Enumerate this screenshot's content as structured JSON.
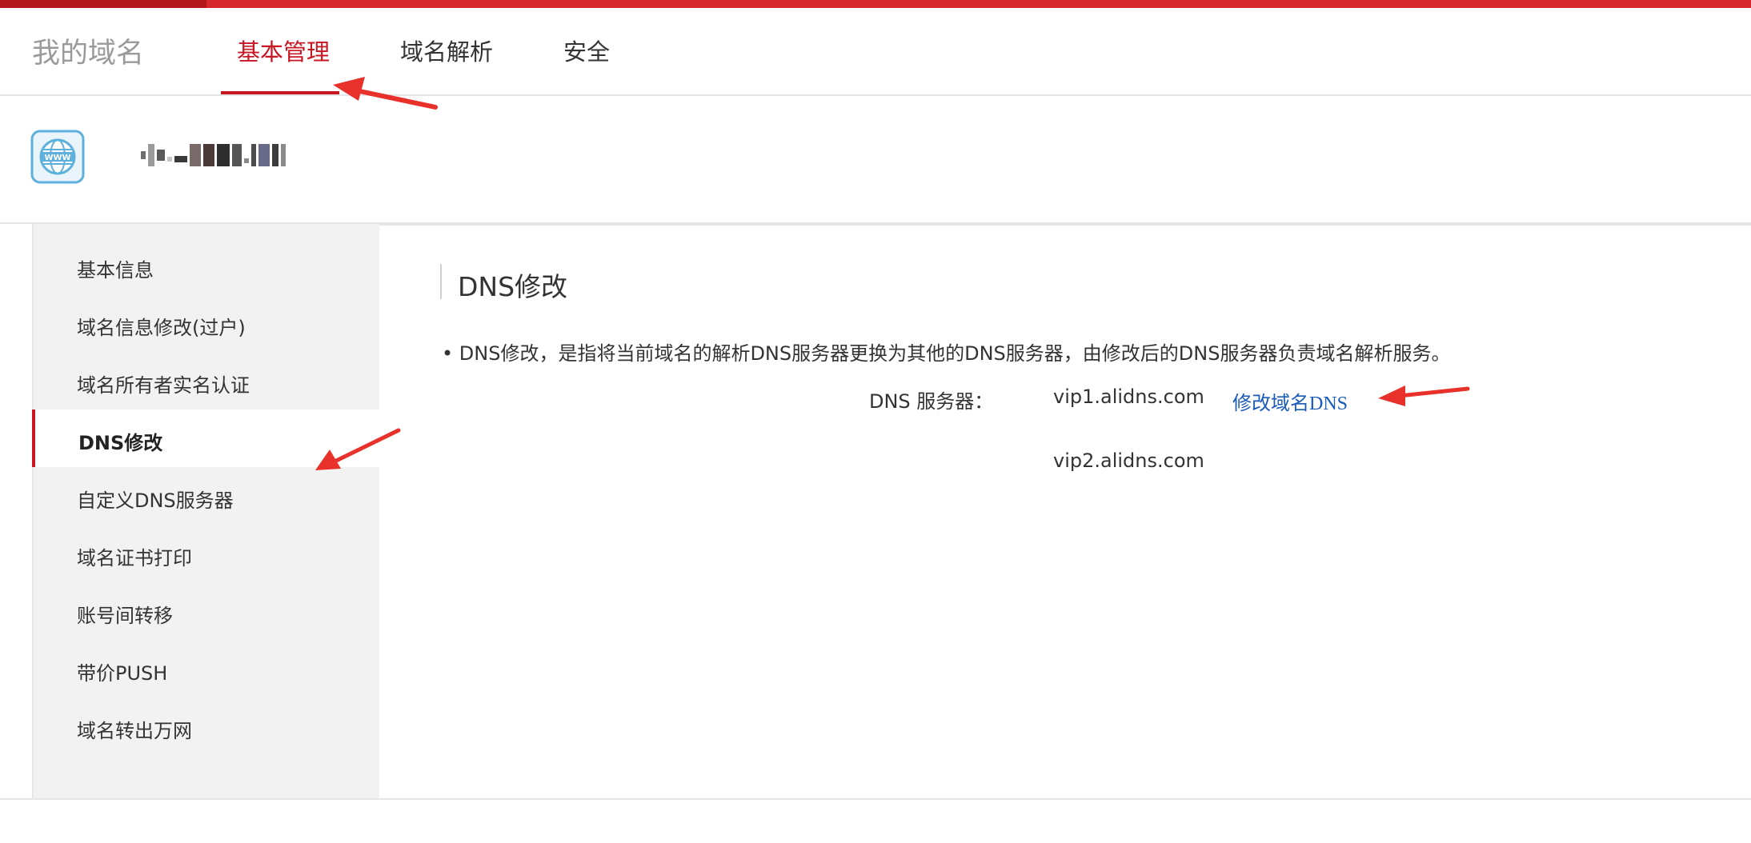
{
  "header": {
    "title": "我的域名",
    "tabs": [
      {
        "label": "基本管理",
        "active": true
      },
      {
        "label": "域名解析",
        "active": false
      },
      {
        "label": "安全",
        "active": false
      }
    ]
  },
  "domain": {
    "icon": "www-globe-icon",
    "name_obscured": true
  },
  "sidebar": {
    "items": [
      {
        "label": "基本信息",
        "active": false
      },
      {
        "label": "域名信息修改(过户)",
        "active": false
      },
      {
        "label": "域名所有者实名认证",
        "active": false
      },
      {
        "label": "DNS修改",
        "active": true
      },
      {
        "label": "自定义DNS服务器",
        "active": false
      },
      {
        "label": "域名证书打印",
        "active": false
      },
      {
        "label": "账号间转移",
        "active": false
      },
      {
        "label": "带价PUSH",
        "active": false
      },
      {
        "label": "域名转出万网",
        "active": false
      }
    ]
  },
  "main": {
    "section_title": "DNS修改",
    "description": "• DNS修改，是指将当前域名的解析DNS服务器更换为其他的DNS服务器，由修改后的DNS服务器负责域名解析服务。",
    "dns_label": "DNS 服务器：",
    "dns_servers": [
      "vip1.alidns.com",
      "vip2.alidns.com"
    ],
    "modify_link": "修改域名DNS"
  },
  "colors": {
    "accent_red": "#c81623",
    "top_strip": "#d7282f",
    "link_blue": "#1a5ab8",
    "annotation_arrow": "#e8312a"
  }
}
